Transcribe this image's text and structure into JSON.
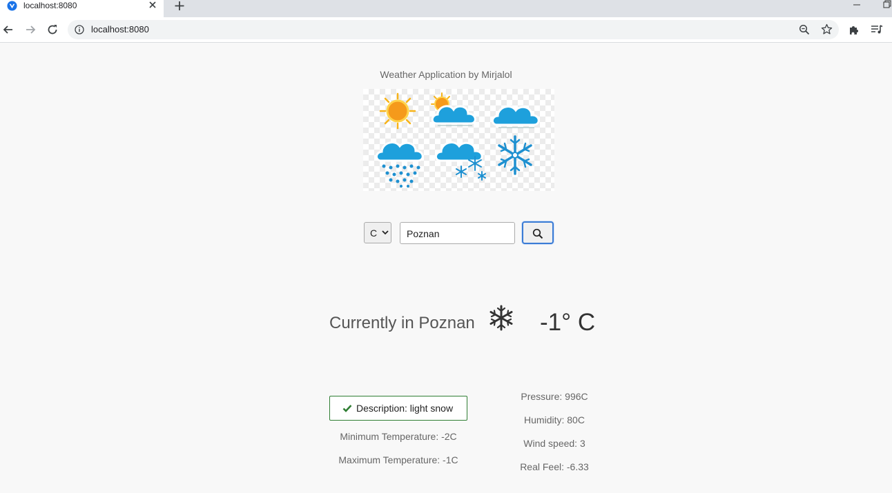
{
  "browser": {
    "tab_title": "localhost:8080",
    "new_tab_label": "+",
    "url": "localhost:8080"
  },
  "app": {
    "title": "Weather Application by Mirjalol",
    "hero_icons": [
      "sun-icon",
      "partly-cloudy-icon",
      "cloud-icon",
      "rain-icon",
      "snow-cloud-icon",
      "snowflake-icon"
    ]
  },
  "search": {
    "unit_value": "C",
    "city_value": "Poznan",
    "button_icon": "search-icon"
  },
  "current": {
    "label": "Currently in Poznan",
    "condition_icon": "snowflake-icon",
    "temperature": "-1° C"
  },
  "details": {
    "description": "Description: light snow",
    "min_temp": "Minimum Temperature: -2C",
    "max_temp": "Maximum Temperature: -1C",
    "pressure": "Pressure: 996C",
    "humidity": "Humidity: 80C",
    "wind_speed": "Wind speed: 3",
    "real_feel": "Real Feel: -6.33"
  },
  "colors": {
    "accent": "#3a7bd5",
    "success": "#2e7d32",
    "sky_blue": "#1ea0dc",
    "sun": "#f7b318"
  }
}
